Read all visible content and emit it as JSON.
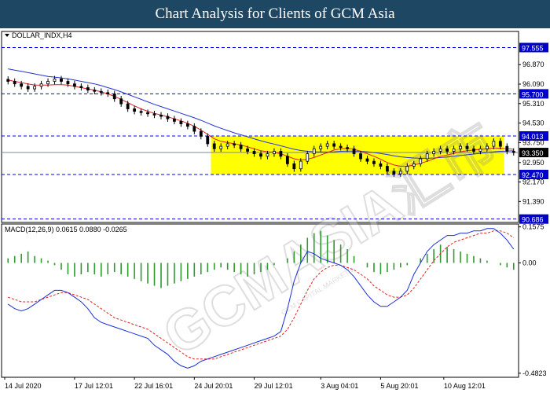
{
  "banner_title": "Chart Analysis for Clients of GCM Asia",
  "watermark": "GCMASIA汇市",
  "watermark_sub": "GCM CAPITAL MARKETS",
  "colors": {
    "banner": "#1d4763",
    "candle": "#000000",
    "sma_fast": "#e0202a",
    "sma_slow": "#2533d6",
    "zone": "#ffff00",
    "level_line": "#0000ff",
    "level_tag": "#0000cc",
    "histogram": "#2e9a2e",
    "macd_line": "#1a2fd8",
    "signal_line": "#e02020"
  },
  "chart_data": [
    {
      "type": "candlestick",
      "symbol_label": "DOLLAR_INDX,H4",
      "ylim": [
        90.55,
        98.2
      ],
      "price_ticks": [
        "96.870",
        "96.090",
        "95.310",
        "94.530",
        "93.750",
        "92.950",
        "92.170",
        "91.390"
      ],
      "price_tick_values": [
        96.87,
        96.09,
        95.31,
        94.53,
        93.75,
        92.95,
        92.17,
        91.39
      ],
      "levels": [
        {
          "label": "97.555",
          "value": 97.555
        },
        {
          "label": "95.700",
          "value": 95.7
        },
        {
          "label": "94.013",
          "value": 94.013
        },
        {
          "label": "92.470",
          "value": 92.47
        },
        {
          "label": "90.686",
          "value": 90.686
        }
      ],
      "current_price": {
        "label": "93.350",
        "value": 93.35
      },
      "consolidation_zone": {
        "top": 94.013,
        "bottom": 92.47,
        "start_index": 31,
        "end_index": 74
      },
      "x_labels": [
        "14 Jul 2020",
        "17 Jul 12:01",
        "22 Jul 16:01",
        "24 Jul 20:01",
        "29 Jul 12:01",
        "3 Aug 04:01",
        "5 Aug 20:01",
        "10 Aug 12:01"
      ],
      "x_label_index": [
        0,
        10.5,
        19.5,
        28.5,
        37.5,
        47.5,
        56.5,
        66
      ],
      "close": [
        96.2,
        96.1,
        96.0,
        95.9,
        96.0,
        96.1,
        96.2,
        96.3,
        96.2,
        96.1,
        96.0,
        95.95,
        95.85,
        95.8,
        95.75,
        95.7,
        95.5,
        95.3,
        95.1,
        95.0,
        94.95,
        94.9,
        94.85,
        94.8,
        94.7,
        94.6,
        94.5,
        94.4,
        94.2,
        94.0,
        93.7,
        93.5,
        93.6,
        93.7,
        93.65,
        93.5,
        93.4,
        93.3,
        93.2,
        93.3,
        93.4,
        93.2,
        92.9,
        92.7,
        93.0,
        93.3,
        93.5,
        93.6,
        93.7,
        93.6,
        93.55,
        93.5,
        93.3,
        93.1,
        93.0,
        92.9,
        92.8,
        92.6,
        92.5,
        92.6,
        92.8,
        92.9,
        93.1,
        93.3,
        93.4,
        93.5,
        93.4,
        93.5,
        93.6,
        93.5,
        93.4,
        93.5,
        93.6,
        93.8,
        93.6,
        93.4,
        93.35
      ],
      "sma_fast": [
        96.25,
        96.2,
        96.15,
        96.1,
        96.05,
        96.05,
        96.05,
        96.07,
        96.07,
        96.05,
        96.0,
        95.95,
        95.9,
        95.85,
        95.78,
        95.7,
        95.6,
        95.48,
        95.35,
        95.22,
        95.1,
        95.0,
        94.92,
        94.85,
        94.78,
        94.7,
        94.62,
        94.52,
        94.4,
        94.25,
        94.08,
        93.9,
        93.8,
        93.75,
        93.7,
        93.65,
        93.58,
        93.5,
        93.42,
        93.38,
        93.36,
        93.3,
        93.2,
        93.1,
        93.05,
        93.08,
        93.15,
        93.25,
        93.35,
        93.45,
        93.5,
        93.52,
        93.48,
        93.4,
        93.3,
        93.2,
        93.08,
        92.95,
        92.85,
        92.8,
        92.8,
        92.85,
        92.92,
        93.0,
        93.1,
        93.2,
        93.25,
        93.32,
        93.38,
        93.42,
        93.45,
        93.47,
        93.5,
        93.53,
        93.52,
        93.5,
        93.48
      ],
      "sma_slow": [
        96.7,
        96.65,
        96.6,
        96.55,
        96.5,
        96.45,
        96.4,
        96.37,
        96.34,
        96.3,
        96.25,
        96.2,
        96.15,
        96.1,
        96.03,
        95.95,
        95.87,
        95.78,
        95.68,
        95.58,
        95.48,
        95.38,
        95.28,
        95.19,
        95.1,
        95.01,
        94.92,
        94.83,
        94.74,
        94.64,
        94.53,
        94.42,
        94.32,
        94.23,
        94.14,
        94.06,
        93.98,
        93.9,
        93.82,
        93.75,
        93.69,
        93.62,
        93.55,
        93.48,
        93.43,
        93.4,
        93.38,
        93.37,
        93.37,
        93.38,
        93.4,
        93.41,
        93.41,
        93.4,
        93.38,
        93.35,
        93.31,
        93.27,
        93.22,
        93.18,
        93.15,
        93.13,
        93.12,
        93.12,
        93.13,
        93.15,
        93.17,
        93.2,
        93.23,
        93.26,
        93.29,
        93.32,
        93.35,
        93.38,
        93.4,
        93.41,
        93.42
      ]
    },
    {
      "type": "line",
      "label": "MACD(12,26,9) 0.0615 0.0880 -0.0265",
      "ylim": [
        -0.5,
        0.17
      ],
      "y_ticks": [
        "0.1575",
        "0.00",
        "-0.4823"
      ],
      "y_tick_values": [
        0.1575,
        0.0,
        -0.4823
      ],
      "histogram": [
        0.02,
        0.03,
        0.04,
        0.05,
        0.03,
        0.02,
        0.01,
        -0.01,
        -0.03,
        -0.05,
        -0.06,
        -0.05,
        -0.04,
        -0.05,
        -0.06,
        -0.05,
        -0.04,
        -0.05,
        -0.06,
        -0.07,
        -0.08,
        -0.09,
        -0.1,
        -0.11,
        -0.1,
        -0.09,
        -0.08,
        -0.07,
        -0.06,
        -0.05,
        -0.04,
        -0.03,
        -0.02,
        -0.03,
        -0.04,
        -0.05,
        -0.06,
        -0.05,
        -0.04,
        -0.03,
        -0.01,
        0.0,
        0.02,
        0.05,
        0.08,
        0.11,
        0.13,
        0.14,
        0.12,
        0.1,
        0.08,
        0.06,
        0.03,
        0.0,
        -0.02,
        -0.04,
        -0.05,
        -0.04,
        -0.03,
        -0.02,
        -0.01,
        0.0,
        0.02,
        0.04,
        0.06,
        0.08,
        0.07,
        0.06,
        0.05,
        0.04,
        0.03,
        0.02,
        0.01,
        0.0,
        -0.01,
        -0.02,
        -0.03
      ],
      "macd": [
        -0.18,
        -0.2,
        -0.21,
        -0.2,
        -0.18,
        -0.16,
        -0.14,
        -0.12,
        -0.12,
        -0.13,
        -0.15,
        -0.17,
        -0.2,
        -0.24,
        -0.26,
        -0.27,
        -0.28,
        -0.29,
        -0.3,
        -0.31,
        -0.32,
        -0.33,
        -0.36,
        -0.38,
        -0.4,
        -0.43,
        -0.45,
        -0.46,
        -0.45,
        -0.43,
        -0.42,
        -0.41,
        -0.4,
        -0.39,
        -0.38,
        -0.37,
        -0.36,
        -0.35,
        -0.34,
        -0.33,
        -0.32,
        -0.3,
        -0.2,
        -0.08,
        0.0,
        0.05,
        0.04,
        0.02,
        0.01,
        0.0,
        -0.01,
        -0.03,
        -0.06,
        -0.1,
        -0.14,
        -0.17,
        -0.19,
        -0.19,
        -0.17,
        -0.15,
        -0.12,
        -0.05,
        0.0,
        0.05,
        0.08,
        0.1,
        0.12,
        0.12,
        0.13,
        0.13,
        0.14,
        0.14,
        0.15,
        0.15,
        0.13,
        0.1,
        0.06
      ],
      "signal": [
        -0.15,
        -0.16,
        -0.17,
        -0.17,
        -0.17,
        -0.16,
        -0.15,
        -0.14,
        -0.13,
        -0.13,
        -0.14,
        -0.15,
        -0.16,
        -0.18,
        -0.2,
        -0.22,
        -0.24,
        -0.25,
        -0.26,
        -0.27,
        -0.28,
        -0.29,
        -0.31,
        -0.33,
        -0.35,
        -0.37,
        -0.39,
        -0.41,
        -0.42,
        -0.42,
        -0.42,
        -0.42,
        -0.41,
        -0.4,
        -0.39,
        -0.38,
        -0.37,
        -0.36,
        -0.35,
        -0.34,
        -0.33,
        -0.32,
        -0.29,
        -0.24,
        -0.18,
        -0.12,
        -0.07,
        -0.04,
        -0.02,
        -0.01,
        -0.01,
        -0.02,
        -0.03,
        -0.05,
        -0.07,
        -0.1,
        -0.12,
        -0.14,
        -0.15,
        -0.15,
        -0.14,
        -0.11,
        -0.07,
        -0.03,
        0.01,
        0.04,
        0.07,
        0.09,
        0.1,
        0.11,
        0.12,
        0.13,
        0.13,
        0.14,
        0.14,
        0.13,
        0.11
      ]
    }
  ]
}
